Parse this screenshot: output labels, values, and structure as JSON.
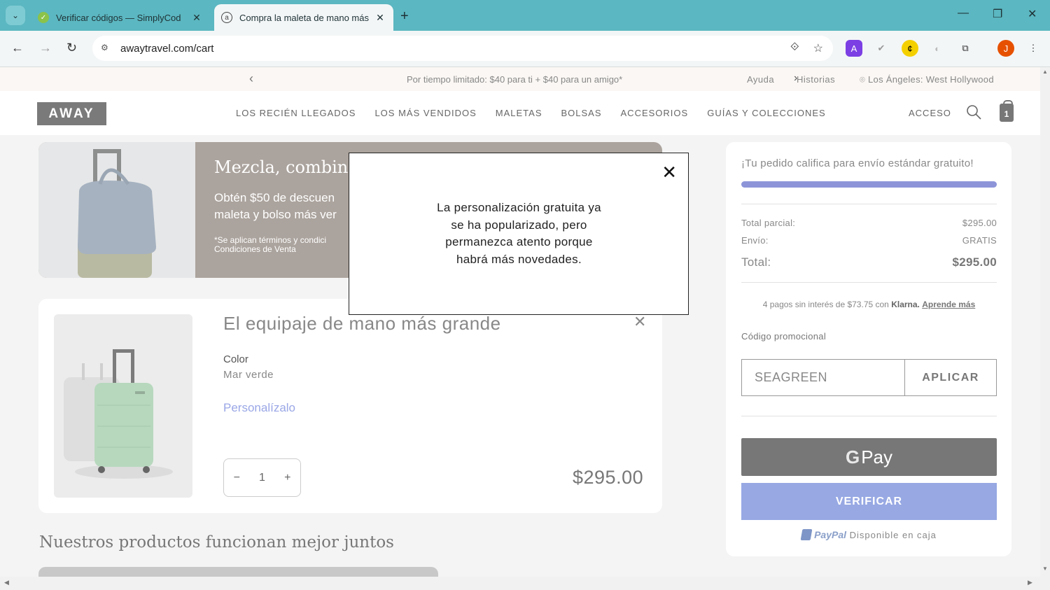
{
  "browser": {
    "tabs": [
      {
        "title": "Verificar códigos — SimplyCod",
        "active": false
      },
      {
        "title": "Compra la maleta de mano más",
        "active": true
      }
    ],
    "url": "awaytravel.com/cart",
    "new_tab_label": "+",
    "profile_initial": "J",
    "extension_a_label": "A"
  },
  "promo_bar": {
    "text": "Por tiempo limitado: $40 para ti + $40 para un amigo*",
    "help": "Ayuda",
    "stories": "Historias",
    "location": "Los Ángeles: West Hollywood"
  },
  "header": {
    "logo": "AWAY",
    "nav": [
      "LOS RECIÉN LLEGADOS",
      "LOS MÁS VENDIDOS",
      "MALETAS",
      "BOLSAS",
      "ACCESORIOS",
      "GUÍAS Y COLECCIONES"
    ],
    "login": "ACCESO",
    "cart_count": "1"
  },
  "banner": {
    "headline": "Mezcla, combina",
    "subtext": "Obtén $50 de descuen maleta y bolso más ver",
    "terms": "*Se aplican términos y condici Condiciones de Venta"
  },
  "cart_item": {
    "title": "El equipaje de mano más grande",
    "color_label": "Color",
    "color_value": "Mar verde",
    "personalize": "Personalízalo",
    "qty_minus": "−",
    "quantity": "1",
    "qty_plus": "+",
    "price": "$295.00"
  },
  "section_title": "Nuestros productos funcionan mejor juntos",
  "summary": {
    "shipping_message": "¡Tu pedido califica para envío estándar gratuito!",
    "shipping_progress": 1.0,
    "subtotal_label": "Total parcial:",
    "subtotal_value": "$295.00",
    "shipping_label": "Envío:",
    "shipping_value": "GRATIS",
    "total_label": "Total:",
    "total_value": "$295.00",
    "klarna_text": "4 pagos sin interés de $73.75 con",
    "klarna_brand": "Klarna.",
    "klarna_link": "Aprende más",
    "promo_label": "Código promocional",
    "promo_value": "SEAGREEN",
    "apply": "APLICAR",
    "gpay_g": "G",
    "gpay_pay": "Pay",
    "verify": "VERIFICAR",
    "paypal_brand": "PayPal",
    "paypal_text": "Disponible en caja"
  },
  "modal": {
    "message": "La personalización gratuita ya se ha popularizado, pero permanezca atento porque habrá más novedades.",
    "close": "✕"
  },
  "colors": {
    "tab_bar": "#5bb7c1",
    "accent_blue": "#97a8e3",
    "progress": "#8d95d8",
    "logo_bg": "#7a7a7a"
  }
}
